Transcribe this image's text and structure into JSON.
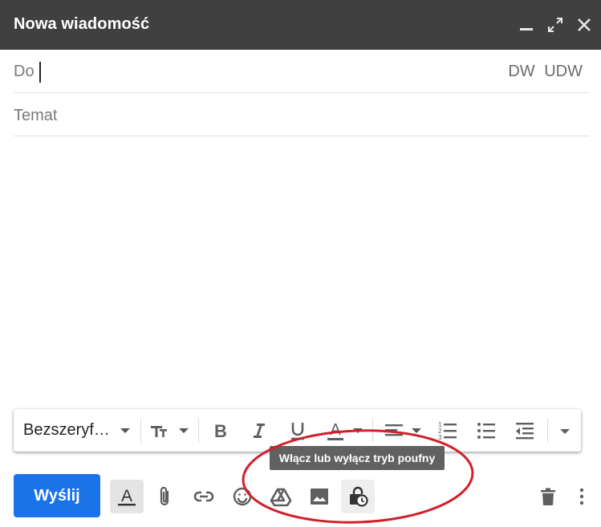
{
  "window": {
    "title": "Nowa wiadomość",
    "controls": [
      "minimize-icon",
      "fullscreen-icon",
      "close-icon"
    ]
  },
  "fields": {
    "to_label": "Do",
    "to_value": "",
    "cc_label": "DW",
    "bcc_label": "UDW",
    "subject_placeholder": "Temat",
    "subject_value": ""
  },
  "formatting": {
    "font": "Bezszeryf…",
    "icons": [
      "text-size-icon",
      "bold-icon",
      "italic-icon",
      "underline-icon",
      "text-color-icon",
      "align-icon",
      "numbered-list-icon",
      "bulleted-list-icon",
      "indent-less-icon",
      "more-formatting-icon"
    ]
  },
  "tooltip": "Włącz lub wyłącz tryb poufny",
  "toolbar": {
    "send_label": "Wyślij",
    "icons": [
      "formatting-options-icon",
      "attach-icon",
      "link-icon",
      "emoji-icon",
      "drive-icon",
      "photo-icon",
      "confidential-mode-icon",
      "delete-icon",
      "more-options-icon"
    ]
  },
  "colors": {
    "header_bg": "#404040",
    "send_button": "#1a73e8",
    "annotation_ellipse": "#d0202a",
    "tooltip_bg": "#616161"
  }
}
